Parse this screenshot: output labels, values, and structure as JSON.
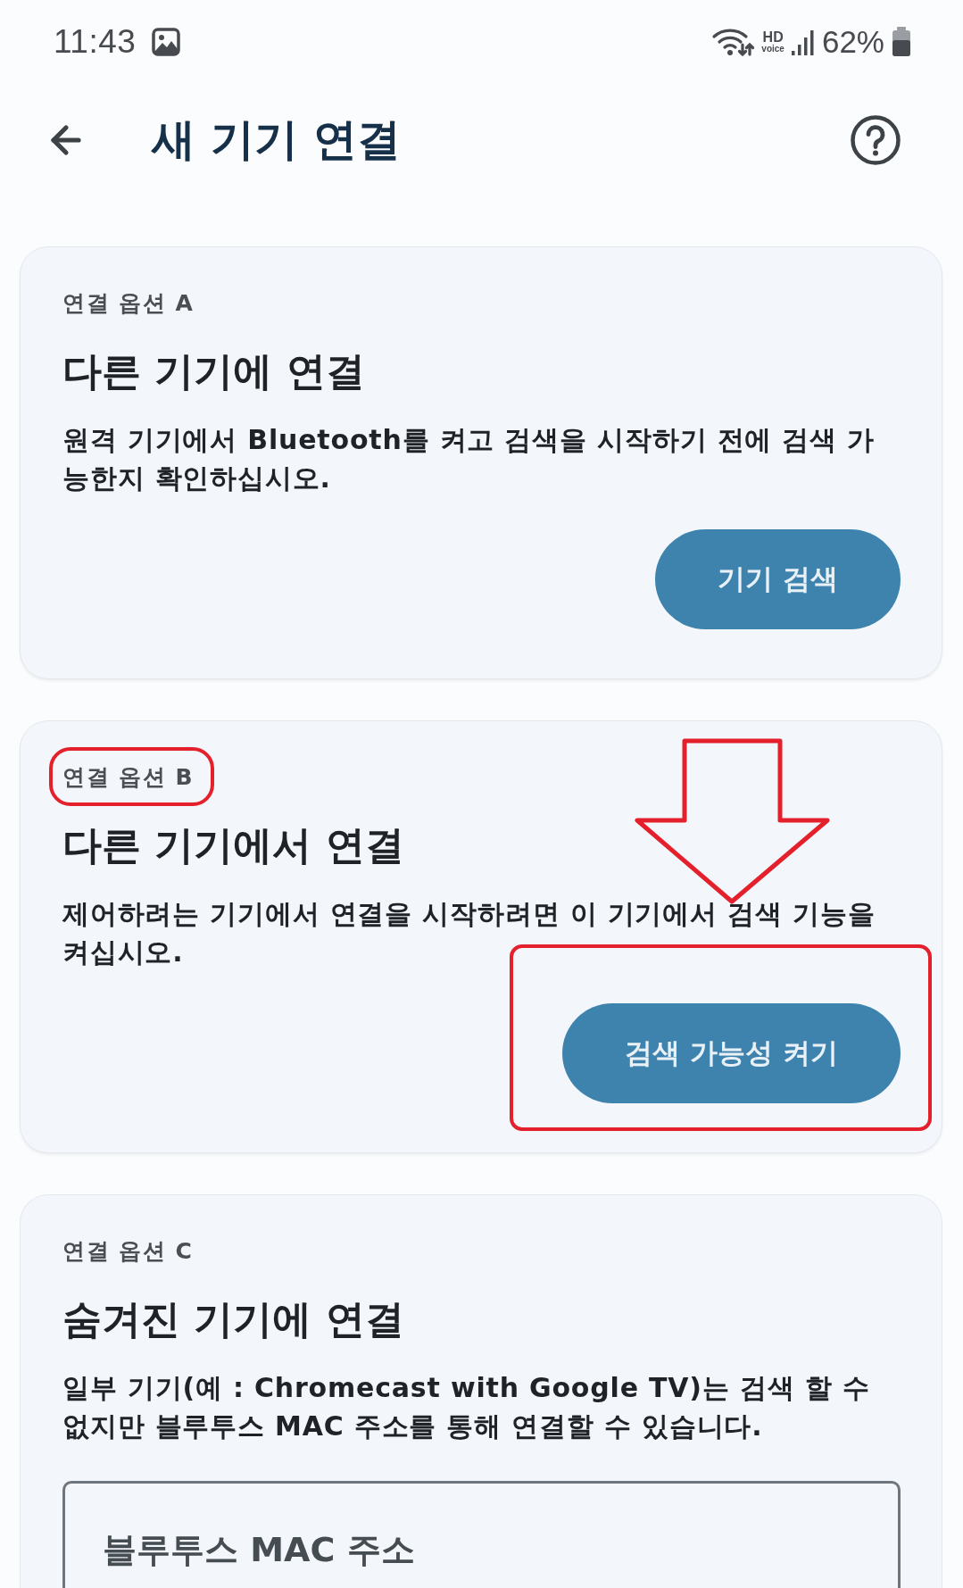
{
  "status_bar": {
    "time": "11:43",
    "hd_voice": [
      "HD",
      "voice"
    ],
    "battery": "62%"
  },
  "header": {
    "title": "새 기기 연결"
  },
  "options": [
    {
      "kind": "action",
      "label": "연결 옵션 A",
      "title": "다른 기기에 연결",
      "description": "원격 기기에서 Bluetooth를 켜고 검색을 시작하기 전에 검색 가능한지 확인하십시오.",
      "button": "기기 검색",
      "annotated": false
    },
    {
      "kind": "action",
      "label": "연결 옵션 B",
      "title": "다른 기기에서 연결",
      "description": "제어하려는 기기에서 연결을 시작하려면 이 기기에서 검색 기능을 켜십시오.",
      "button": "검색 가능성 켜기",
      "annotated": true
    },
    {
      "kind": "input",
      "label": "연결 옵션 C",
      "title": "숨겨진 기기에 연결",
      "description": "일부 기기(예 : Chromecast with Google TV)는 검색 할 수 없지만 블루투스 MAC 주소를 통해 연결할 수 있습니다.",
      "field": {
        "placeholder": "블루투스 MAC 주소"
      },
      "annotated": false
    }
  ]
}
